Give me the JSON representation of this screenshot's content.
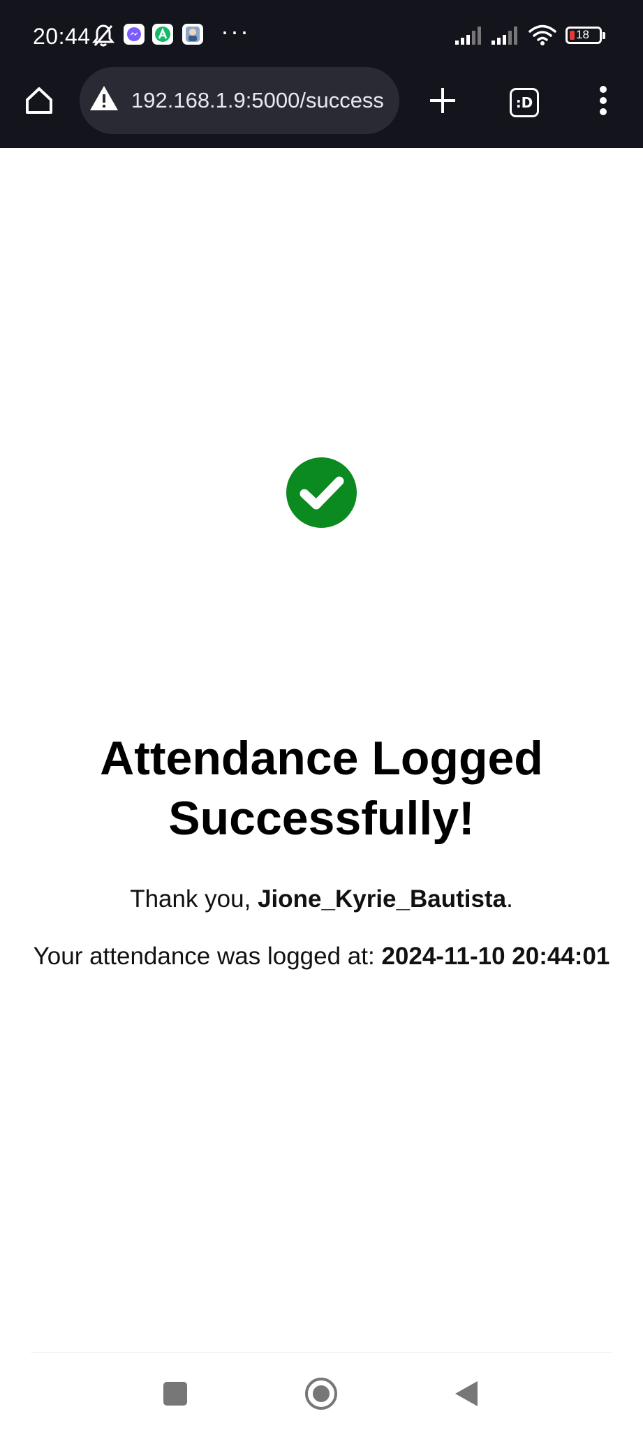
{
  "status_bar": {
    "time": "20:44",
    "battery_level": "18",
    "icons": [
      "bell-off-icon",
      "messenger-icon",
      "app-icon",
      "avatar-app-icon",
      "more-notifications-icon",
      "signal-icon",
      "signal-icon",
      "wifi-icon",
      "battery-icon"
    ]
  },
  "browser": {
    "url": "192.168.1.9:5000/success",
    "tabs_label": ":D",
    "icons": [
      "home-icon",
      "not-secure-warning-icon",
      "new-tab-icon",
      "tab-switcher-icon",
      "menu-icon"
    ]
  },
  "page": {
    "title": "Attendance Logged Successfully!",
    "thanks_prefix": "Thank you, ",
    "user_name": "Jione_Kyrie_Bautista",
    "thanks_suffix": ".",
    "logged_prefix": "Your attendance was logged at: ",
    "logged_time": "2024-11-10 20:44:01",
    "success_color": "#0a8a1f"
  },
  "nav_bar": {
    "icons": [
      "recents-icon",
      "home-circle-icon",
      "back-icon"
    ]
  }
}
